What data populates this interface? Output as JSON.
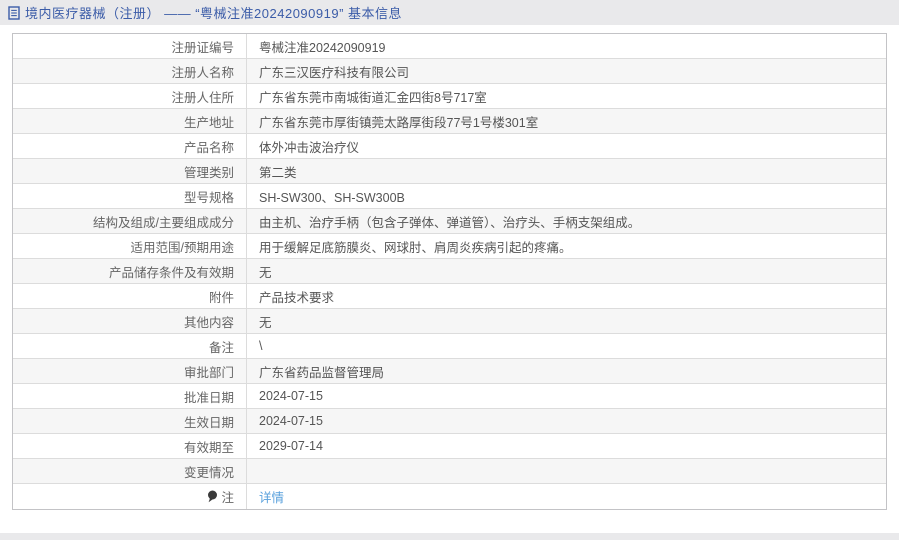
{
  "header": {
    "title": "境内医疗器械（注册） —— “粤械注准20242090919” 基本信息"
  },
  "colors": {
    "title_blue": "#3b5ca8",
    "link_blue": "#58a0dc",
    "bar_background": "#e9e9eb",
    "row_alt_background": "#f6f6f6",
    "border": "#dcdcdc"
  },
  "table": {
    "rows": [
      {
        "label": "注册证编号",
        "value": "粤械注准20242090919"
      },
      {
        "label": "注册人名称",
        "value": "广东三汉医疗科技有限公司"
      },
      {
        "label": "注册人住所",
        "value": "广东省东莞市南城街道汇金四街8号717室"
      },
      {
        "label": "生产地址",
        "value": "广东省东莞市厚街镇莞太路厚街段77号1号楼301室"
      },
      {
        "label": "产品名称",
        "value": "体外冲击波治疗仪"
      },
      {
        "label": "管理类别",
        "value": "第二类"
      },
      {
        "label": "型号规格",
        "value": "SH-SW300、SH-SW300B"
      },
      {
        "label": "结构及组成/主要组成成分",
        "value": "由主机、治疗手柄（包含子弹体、弹道管）、治疗头、手柄支架组成。"
      },
      {
        "label": "适用范围/预期用途",
        "value": "用于缓解足底筋膜炎、网球肘、肩周炎疾病引起的疼痛。"
      },
      {
        "label": "产品储存条件及有效期",
        "value": "无"
      },
      {
        "label": "附件",
        "value": "产品技术要求"
      },
      {
        "label": "其他内容",
        "value": "无"
      },
      {
        "label": "备注",
        "value": "\\"
      },
      {
        "label": "审批部门",
        "value": "广东省药品监督管理局"
      },
      {
        "label": "批准日期",
        "value": "2024-07-15"
      },
      {
        "label": "生效日期",
        "value": "2024-07-15"
      },
      {
        "label": "有效期至",
        "value": "2029-07-14"
      },
      {
        "label": "变更情况",
        "value": ""
      },
      {
        "label": "注",
        "value": "详情",
        "link": true,
        "label_icon": "note-balloon-icon"
      }
    ]
  }
}
